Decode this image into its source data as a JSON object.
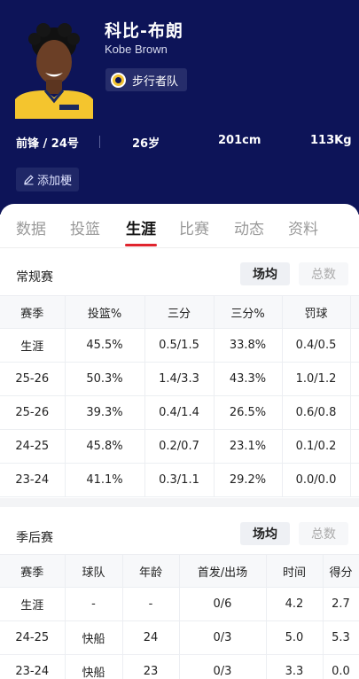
{
  "player": {
    "name_cn": "科比-布朗",
    "name_en": "Kobe Brown",
    "team": "步行者队",
    "position_number": "前锋 / 24号",
    "age": "26岁",
    "height": "201cm",
    "weight": "113Kg",
    "add_label": "添加梗"
  },
  "colors": {
    "header_bg": "#0d1458",
    "tab_accent": "#e0242d"
  },
  "tabs": [
    {
      "label": "数据"
    },
    {
      "label": "投篮"
    },
    {
      "label": "生涯"
    },
    {
      "label": "比赛"
    },
    {
      "label": "动态"
    },
    {
      "label": "资料"
    }
  ],
  "active_tab": "生涯",
  "regular": {
    "title": "常规赛",
    "toggle_avg": "场均",
    "toggle_total": "总数",
    "headers": [
      "赛季",
      "投篮%",
      "三分",
      "三分%",
      "罚球"
    ],
    "rows": [
      [
        "生涯",
        "45.5%",
        "0.5/1.5",
        "33.8%",
        "0.4/0.5"
      ],
      [
        "25-26",
        "50.3%",
        "1.4/3.3",
        "43.3%",
        "1.0/1.2"
      ],
      [
        "25-26",
        "39.3%",
        "0.4/1.4",
        "26.5%",
        "0.6/0.8"
      ],
      [
        "24-25",
        "45.8%",
        "0.2/0.7",
        "23.1%",
        "0.1/0.2"
      ],
      [
        "23-24",
        "41.1%",
        "0.3/1.1",
        "29.2%",
        "0.0/0.0"
      ]
    ]
  },
  "playoffs": {
    "title": "季后赛",
    "toggle_avg": "场均",
    "toggle_total": "总数",
    "headers": [
      "赛季",
      "球队",
      "年龄",
      "首发/出场",
      "时间",
      "得分"
    ],
    "rows": [
      [
        "生涯",
        "-",
        "-",
        "0/6",
        "4.2",
        "2.7"
      ],
      [
        "24-25",
        "快船",
        "24",
        "0/3",
        "5.0",
        "5.3"
      ],
      [
        "23-24",
        "快船",
        "23",
        "0/3",
        "3.3",
        "0.0"
      ]
    ]
  }
}
